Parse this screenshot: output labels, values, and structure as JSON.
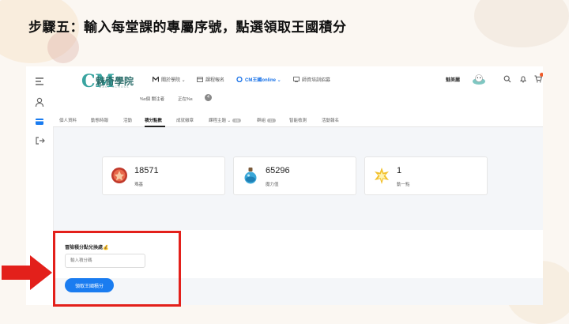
{
  "slide": {
    "title": "步驟五：輸入每堂課的專屬序號，點選領取王國積分"
  },
  "app": {
    "logo": {
      "mark": "CM",
      "text": "魅奇學院",
      "subtitle": "MAGI SCHOOL"
    },
    "nav": [
      {
        "label": "關於學院",
        "has_caret": true,
        "icon": "m-logo-icon"
      },
      {
        "label": "課程報名",
        "icon": "calendar-icon"
      },
      {
        "label": "CM王國online",
        "has_caret": true,
        "active": true,
        "icon": "cm-logo-icon"
      },
      {
        "label": "師資培訓招募",
        "icon": "chalkboard-icon"
      }
    ],
    "user_name": "魅美麗",
    "cart_badge_color": "#f05a28",
    "accent": "#1a7cf0"
  },
  "profile_info": {
    "followers": "%s個 關注者",
    "following": "正在%s",
    "badge": "4"
  },
  "tabs": [
    {
      "label": "個人資料"
    },
    {
      "label": "動態時報"
    },
    {
      "label": "活動"
    },
    {
      "label": "積分點數",
      "active": true
    },
    {
      "label": "成就徽章"
    },
    {
      "label": "課程主題",
      "has_caret": true,
      "count": "46"
    },
    {
      "label": "群組",
      "count": "11"
    },
    {
      "label": "智能檢測"
    },
    {
      "label": "活動報名"
    }
  ],
  "points": [
    {
      "value": "18571",
      "label": "瑪基",
      "icon": "red-emblem-icon"
    },
    {
      "value": "65296",
      "label": "魔力值",
      "icon": "potion-icon"
    },
    {
      "value": "1",
      "label": "動一點",
      "icon": "star-burst-icon"
    }
  ],
  "exchange": {
    "title": "冒險積分點兌換處💰",
    "input_placeholder": "輸入積分碼",
    "button_label": "領取王國積分"
  },
  "annotation": {
    "highlight_color": "#e3201b"
  }
}
